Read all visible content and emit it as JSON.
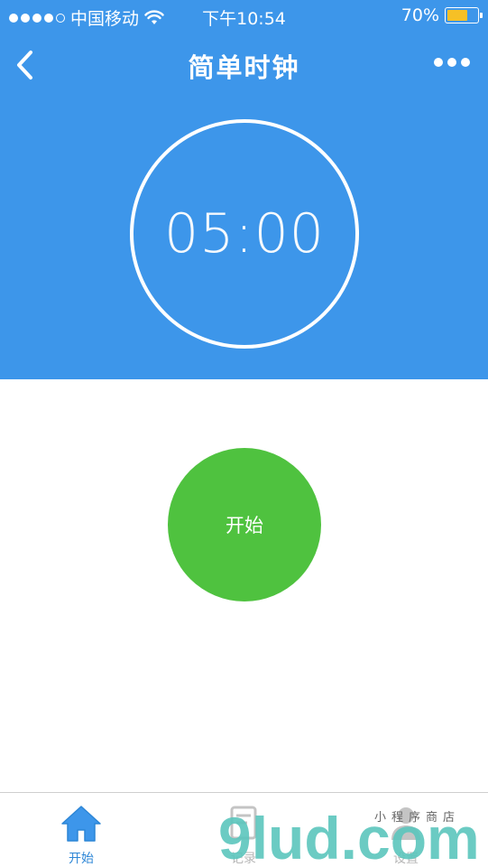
{
  "status_bar": {
    "carrier": "中国移动",
    "time": "下午10:54",
    "battery_percent": "70%",
    "battery_level": 0.7
  },
  "nav": {
    "title": "简单时钟"
  },
  "timer": {
    "display": "05:00"
  },
  "start_button": {
    "label": "开始"
  },
  "tabs": [
    {
      "label": "开始",
      "active": true,
      "icon": "home-icon"
    },
    {
      "label": "记录",
      "active": false,
      "icon": "record-icon"
    },
    {
      "label": "设置",
      "active": false,
      "icon": "user-icon"
    }
  ],
  "colors": {
    "primary": "#3d96ea",
    "start_green": "#4fc23f",
    "tab_active": "#2d86d6"
  },
  "watermark": {
    "text": "9lud.com",
    "subtext": "小程序商店"
  }
}
